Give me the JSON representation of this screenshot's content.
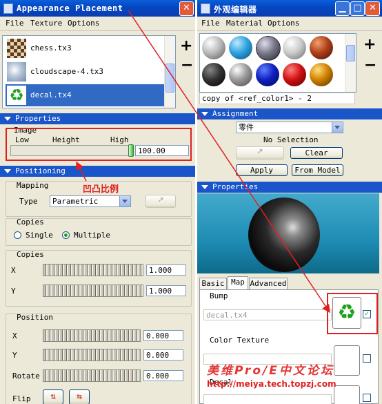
{
  "left": {
    "title": "Appearance Placement",
    "menu": [
      "File",
      "Texture",
      "Options"
    ],
    "textures": [
      {
        "name": "chess.tx3"
      },
      {
        "name": "cloudscape-4.tx3"
      },
      {
        "name": "decal.tx4",
        "selected": true
      }
    ],
    "side_buttons": [
      "+",
      "−"
    ],
    "properties": {
      "header": "Properties",
      "image_label": "Image",
      "low": "Low",
      "height": "Height",
      "high": "High",
      "value": "100.00",
      "slider_fraction": 1.0
    },
    "positioning": {
      "header": "Positioning",
      "mapping_label": "Mapping",
      "type_label": "Type",
      "type_value": "Parametric",
      "annotation": "凹凸比例",
      "copies_label": "Copies",
      "single": "Single",
      "multiple": "Multiple",
      "copies2_label": "Copies",
      "x_label": "X",
      "y_label": "Y",
      "copies_x": "1.000",
      "copies_y": "1.000",
      "position_label": "Position",
      "pos_x_label": "X",
      "pos_y_label": "Y",
      "rotate_label": "Rotate",
      "pos_x": "0.000",
      "pos_y": "0.000",
      "rotate": "0.000",
      "flip_label": "Flip"
    }
  },
  "right": {
    "title": "外观编辑器",
    "menu": [
      "File",
      "Material",
      "Options"
    ],
    "material_name": "copy of <ref_color1> - 2",
    "side_buttons": [
      "+",
      "−"
    ],
    "assignment": {
      "header": "Assignment",
      "select_value": "零件",
      "status": "No Selection",
      "clear": "Clear",
      "apply": "Apply",
      "from_model": "From Model"
    },
    "properties": {
      "header": "Properties",
      "tabs": [
        "Basic",
        "Map",
        "Advanced"
      ],
      "active_tab": "Map",
      "bump_label": "Bump",
      "bump_value": "decal.tx4",
      "color_texture_label": "Color Texture",
      "decal_label": "Decal"
    },
    "watermark": {
      "line1": "美维Pro/E中文论坛",
      "line2": "http://meiya.tech.topzj.com"
    }
  },
  "colors": {
    "title_blue": "#0548c4",
    "section_blue": "#1a55c9",
    "selection": "#316ac5",
    "annotation_red": "#e02020"
  }
}
